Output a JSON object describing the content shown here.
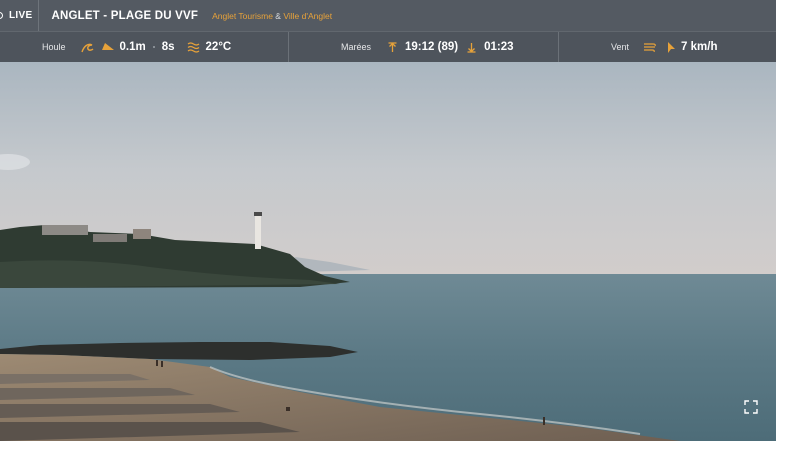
{
  "topbar": {
    "live_label": "LIVE",
    "title": "ANGLET - PLAGE DU VVF",
    "credit_1": "Anglet Tourisme",
    "credit_sep": "&",
    "credit_2": "Ville d'Anglet"
  },
  "conditions": {
    "swell": {
      "label": "Houle",
      "height": "0.1m",
      "period": "8s",
      "water_temp": "22°C"
    },
    "tides": {
      "label": "Marées",
      "high_time": "19:12 (89)",
      "low_time": "01:23"
    },
    "wind": {
      "label": "Vent",
      "speed": "7 km/h"
    }
  },
  "icons": {
    "live": "live-record-icon",
    "wave": "wave-icon",
    "swell_direction": "swell-direction-icon",
    "water_temperature": "water-temperature-icon",
    "high_tide": "high-tide-icon",
    "low_tide": "low-tide-icon",
    "wind": "wind-icon",
    "wind_direction": "wind-direction-icon",
    "fullscreen": "fullscreen-icon"
  },
  "colors": {
    "bar_background": "#545a62",
    "accent": "#e7a23a"
  }
}
